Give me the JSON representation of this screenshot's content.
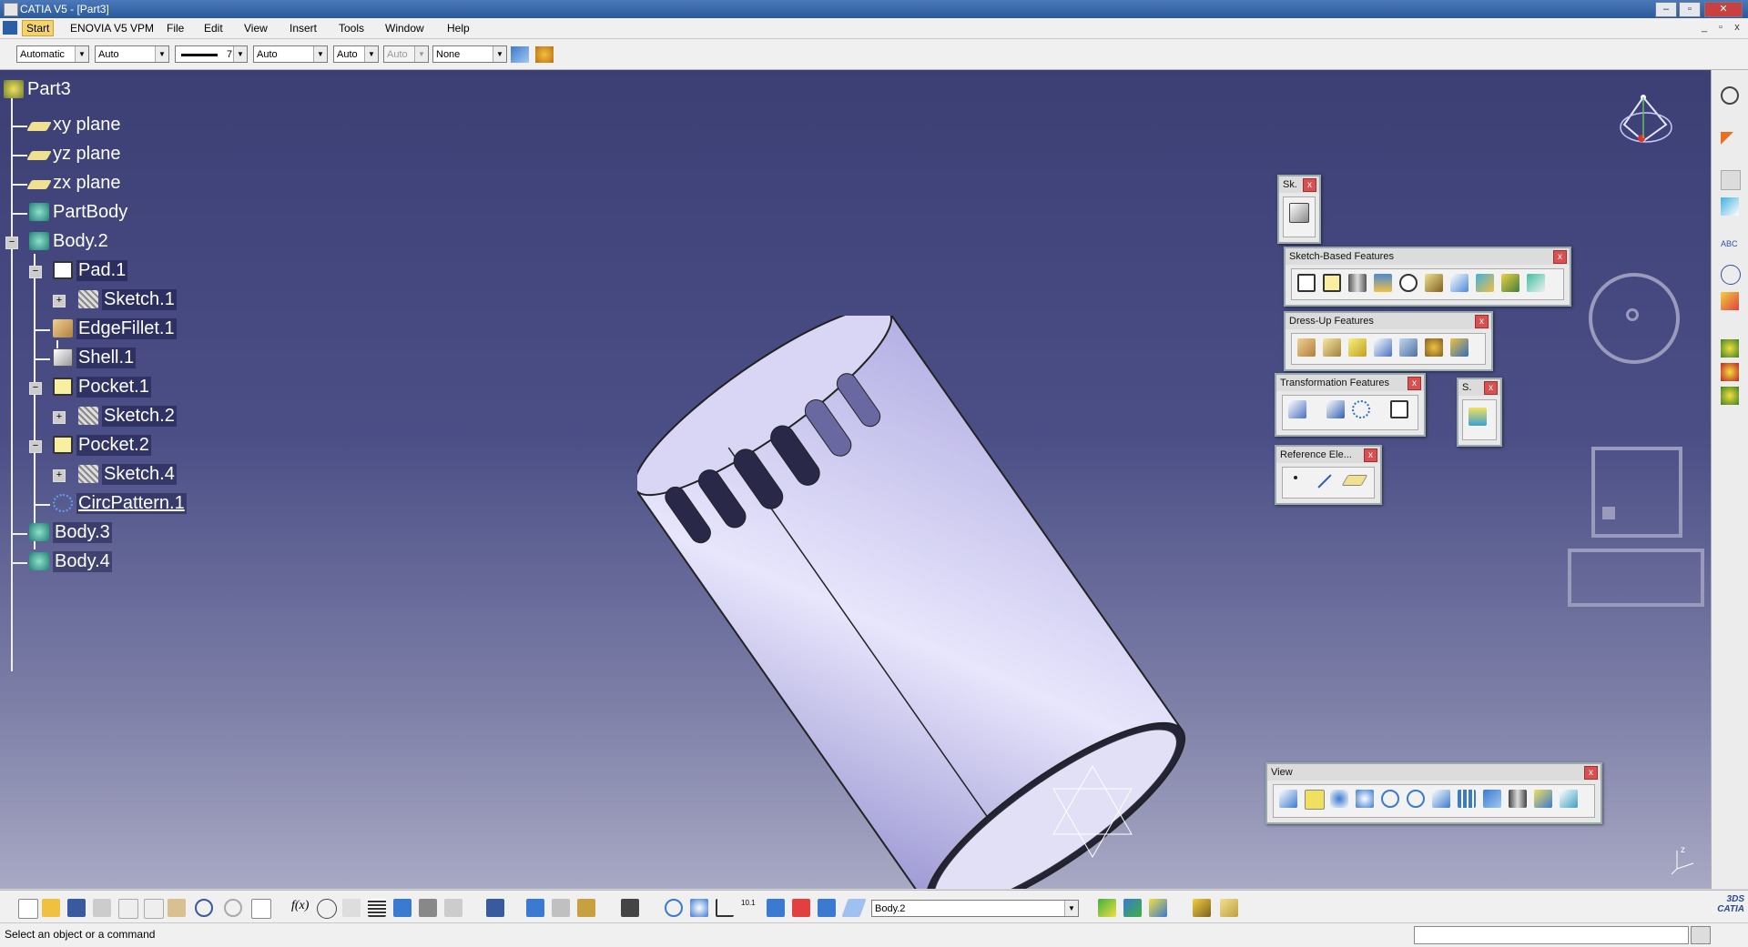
{
  "window": {
    "title": "CATIA V5 - [Part3]"
  },
  "menu": {
    "items": [
      "Start",
      "ENOVIA V5 VPM",
      "File",
      "Edit",
      "View",
      "Insert",
      "Tools",
      "Window",
      "Help"
    ]
  },
  "properties": {
    "color": "Automatic",
    "transparency": "Auto",
    "line_weight": "7",
    "line_type": "Auto",
    "point_type": "Auto",
    "layer_disabled": "Auto",
    "layer": "None"
  },
  "tree": {
    "root": "Part3",
    "xy": "xy plane",
    "yz": "yz plane",
    "zx": "zx plane",
    "partbody": "PartBody",
    "body2": "Body.2",
    "pad1": "Pad.1",
    "sketch1": "Sketch.1",
    "edgefillet1": "EdgeFillet.1",
    "shell1": "Shell.1",
    "pocket1": "Pocket.1",
    "sketch2": "Sketch.2",
    "pocket2": "Pocket.2",
    "sketch4": "Sketch.4",
    "circpattern1": "CircPattern.1",
    "body3": "Body.3",
    "body4": "Body.4"
  },
  "panels": {
    "sketcher": "Sk.",
    "sketch_based": "Sketch-Based Features",
    "dress_up": "Dress-Up Features",
    "transformation": "Transformation Features",
    "surface": "S.",
    "reference": "Reference Ele...",
    "view": "View"
  },
  "bottom": {
    "work_object": "Body.2"
  },
  "status": {
    "message": "Select an object or a command"
  },
  "colors": {
    "viewport_top": "#3c3f74",
    "viewport_bottom": "#a8a9c4",
    "part": "#c8c6ec"
  }
}
